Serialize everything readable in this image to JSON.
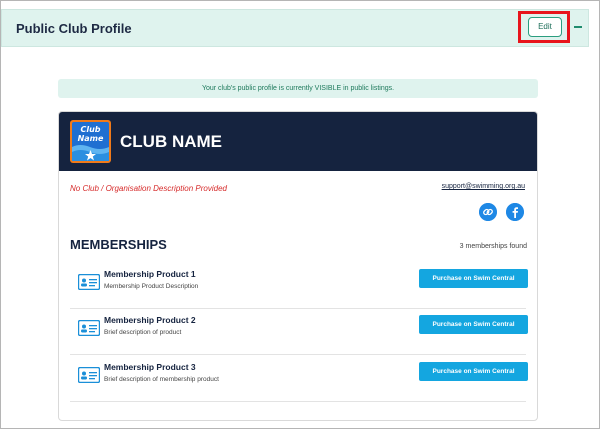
{
  "header": {
    "title": "Public Club Profile",
    "edit_label": "Edit",
    "collapse_icon": "minus-icon"
  },
  "banner": {
    "text": "Your club's public profile is currently VISIBLE in public listings."
  },
  "club": {
    "name": "CLUB NAME",
    "description": "No Club / Organisation Description Provided",
    "support_email": "support@swimming.org.au",
    "logo_text": [
      "Club",
      "Name"
    ]
  },
  "social": {
    "link_icon": "link-icon",
    "facebook_icon": "facebook-icon"
  },
  "memberships": {
    "title": "MEMBERSHIPS",
    "count_text": "3 memberships found",
    "items": [
      {
        "name": "Membership Product 1",
        "description": "Membership Product Description",
        "button": "Purchase on Swim Central"
      },
      {
        "name": "Membership Product 2",
        "description": "Brief description of product",
        "button": "Purchase on Swim Central"
      },
      {
        "name": "Membership Product 3",
        "description": "Brief description of membership product",
        "button": "Purchase on Swim Central"
      }
    ]
  },
  "colors": {
    "header_bg": "#dff3ee",
    "card_header_bg": "#15233f",
    "accent": "#14a6e0",
    "highlight": "#e8141c",
    "error_text": "#d62a2a"
  }
}
